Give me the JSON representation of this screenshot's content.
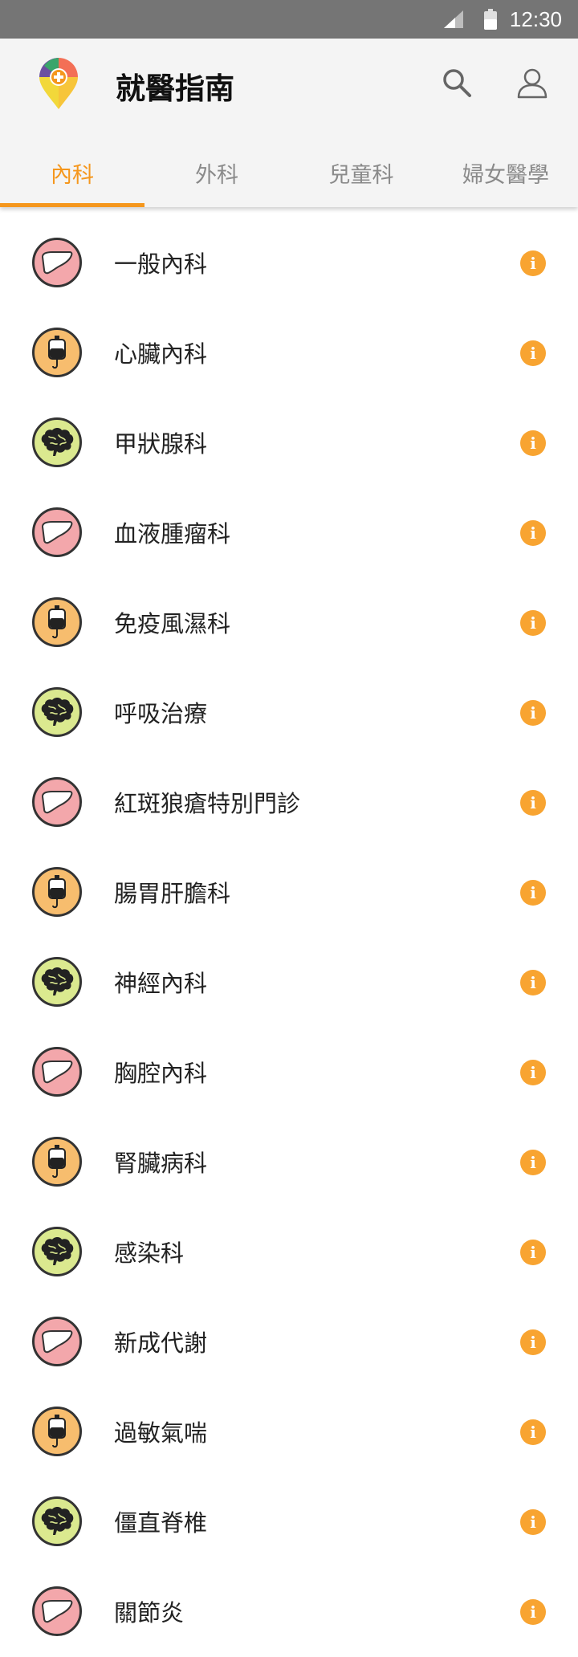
{
  "status": {
    "time": "12:30"
  },
  "app": {
    "title": "就醫指南"
  },
  "tabs": [
    {
      "label": "內科",
      "active": true
    },
    {
      "label": "外科",
      "active": false
    },
    {
      "label": "兒童科",
      "active": false
    },
    {
      "label": "婦女醫學",
      "active": false
    }
  ],
  "colors": {
    "accent": "#f5971d",
    "pink": "#f3a7ab",
    "orange": "#f7bd6e",
    "green": "#dbe98f"
  },
  "list": [
    {
      "label": "一般內科",
      "icon": "liver-icon"
    },
    {
      "label": "心臟內科",
      "icon": "iv-bag-icon"
    },
    {
      "label": "甲狀腺科",
      "icon": "brain-icon"
    },
    {
      "label": "血液腫瘤科",
      "icon": "liver-icon"
    },
    {
      "label": "免疫風濕科",
      "icon": "iv-bag-icon"
    },
    {
      "label": "呼吸治療",
      "icon": "brain-icon"
    },
    {
      "label": "紅斑狼瘡特別門診",
      "icon": "liver-icon"
    },
    {
      "label": "腸胃肝膽科",
      "icon": "iv-bag-icon"
    },
    {
      "label": "神經內科",
      "icon": "brain-icon"
    },
    {
      "label": "胸腔內科",
      "icon": "liver-icon"
    },
    {
      "label": "腎臟病科",
      "icon": "iv-bag-icon"
    },
    {
      "label": "感染科",
      "icon": "brain-icon"
    },
    {
      "label": "新成代謝",
      "icon": "liver-icon"
    },
    {
      "label": "過敏氣喘",
      "icon": "iv-bag-icon"
    },
    {
      "label": "僵直脊椎",
      "icon": "brain-icon"
    },
    {
      "label": "關節炎",
      "icon": "liver-icon"
    }
  ]
}
